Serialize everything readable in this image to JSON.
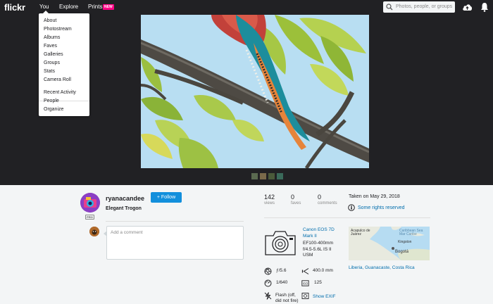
{
  "nav": {
    "logo": "flickr",
    "you": "You",
    "explore": "Explore",
    "prints": "Prints",
    "prints_badge": "NEW",
    "search_placeholder": "Photos, people, or groups"
  },
  "you_menu": {
    "items": [
      "About",
      "Photostream",
      "Albums",
      "Faves",
      "Galleries",
      "Groups",
      "Stats",
      "Camera Roll"
    ],
    "items2": [
      "Recent Activity",
      "People",
      "Organize"
    ]
  },
  "owner": {
    "username": "ryanacandee",
    "follow_label": "+ Follow",
    "pro_badge": "PRO"
  },
  "photo": {
    "title": "Elegant Trogon"
  },
  "comment": {
    "placeholder": "Add a comment"
  },
  "stats": {
    "views": "142",
    "views_label": "views",
    "faves": "0",
    "faves_label": "faves",
    "comments": "0",
    "comments_label": "comments"
  },
  "taken": "Taken on May 29, 2018",
  "rights": "Some rights reserved",
  "camera": {
    "model_line1": "Canon EOS 7D",
    "model_line2": "Mark II",
    "lens_line1": "EF100-400mm",
    "lens_line2": "f/4.5-5.6L IS II",
    "lens_line3": "USM"
  },
  "map": {
    "label_acapulco_1": "Acapulco de",
    "label_acapulco_2": "Juárez",
    "label_caribbean_1": "Caribbean Sea",
    "label_caribbean_2": "Mar Caribe",
    "label_kingston": "Kingston",
    "label_bogota": "Bogotá"
  },
  "location": "Liberia, Guanacaste, Costa Rica",
  "exif": {
    "aperture": "ƒ/5.6",
    "focal_length": "400.0 mm",
    "shutter": "1/640",
    "iso": "125",
    "flash_line1": "Flash (off,",
    "flash_line2": "did not fire)",
    "show_exif": "Show EXIF"
  },
  "colors": {
    "nav_bg": "#212124",
    "accent": "#128fdc",
    "link": "#006dac",
    "badge": "#ff0084"
  }
}
